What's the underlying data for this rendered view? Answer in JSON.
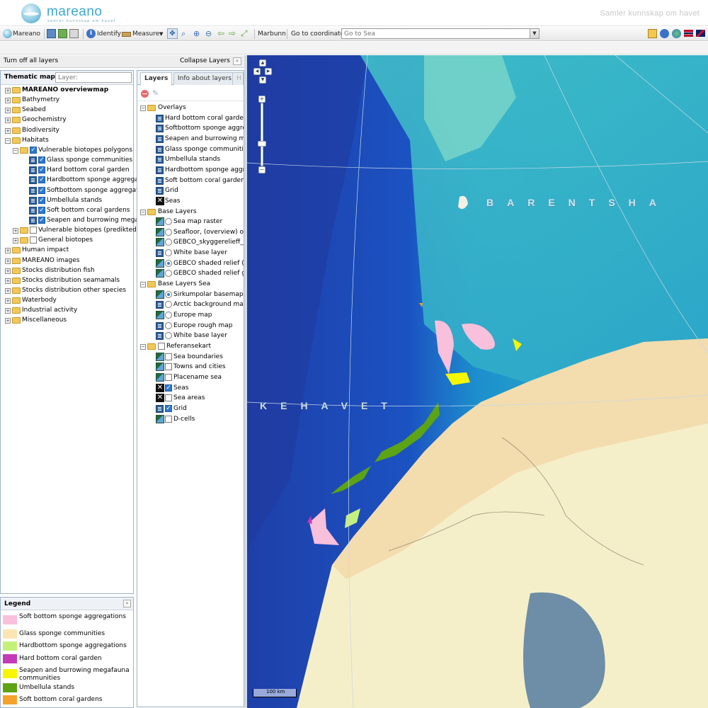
{
  "header": {
    "brand": "mareano",
    "brand_sub": "samler kunnskap om havet",
    "tagline": "Samler kunnskap om havet"
  },
  "toolbar": {
    "home_label": "Mareano",
    "identify_label": "Identify",
    "measure_label": "Measure",
    "marbunn_label": "Marbunn",
    "goto_coordinate_label": "Go to coordinate",
    "goto_sea_placeholder": "Go to Sea"
  },
  "left_panel": {
    "turn_off_label": "Turn off all layers",
    "collapse_label": "Collapse Layers"
  },
  "thematic": {
    "title": "Thematic maps",
    "layer_placeholder": "Layer:",
    "items": [
      {
        "label": "MAREANO overviewmap",
        "bold": true,
        "level": 0,
        "type": "folder"
      },
      {
        "label": "Bathymetry",
        "level": 0,
        "type": "folder"
      },
      {
        "label": "Seabed",
        "level": 0,
        "type": "folder"
      },
      {
        "label": "Geochemistry",
        "level": 0,
        "type": "folder"
      },
      {
        "label": "Biodiversity",
        "level": 0,
        "type": "folder"
      },
      {
        "label": "Habitats",
        "level": 0,
        "type": "folder",
        "expanded": true
      },
      {
        "label": "Vulnerable biotopes polygons",
        "level": 1,
        "type": "folder-check",
        "checked": true,
        "expanded": true
      },
      {
        "label": "Glass sponge communities",
        "level": 2,
        "type": "layer",
        "checked": true
      },
      {
        "label": "Hard bottom coral garden",
        "level": 2,
        "type": "layer",
        "checked": true
      },
      {
        "label": "Hardbottom sponge aggregations",
        "level": 2,
        "type": "layer",
        "checked": true
      },
      {
        "label": "Softbottom sponge aggregations",
        "level": 2,
        "type": "layer",
        "checked": true
      },
      {
        "label": "Umbellula stands",
        "level": 2,
        "type": "layer",
        "checked": true
      },
      {
        "label": "Soft bottom coral gardens",
        "level": 2,
        "type": "layer",
        "checked": true
      },
      {
        "label": "Seapen and burrowing megafauna",
        "level": 2,
        "type": "layer",
        "checked": true
      },
      {
        "label": "Vulnerable biotopes (predikted)",
        "level": 1,
        "type": "folder-check",
        "checked": false
      },
      {
        "label": "General biotopes",
        "level": 1,
        "type": "folder-check",
        "checked": false
      },
      {
        "label": "Human impact",
        "level": 0,
        "type": "folder"
      },
      {
        "label": "MAREANO images",
        "level": 0,
        "type": "folder"
      },
      {
        "label": "Stocks distribution fish",
        "level": 0,
        "type": "folder"
      },
      {
        "label": "Stocks distribution seamamals",
        "level": 0,
        "type": "folder"
      },
      {
        "label": "Stocks distribution other species",
        "level": 0,
        "type": "folder"
      },
      {
        "label": "Waterbody",
        "level": 0,
        "type": "folder"
      },
      {
        "label": "Industrial activity",
        "level": 0,
        "type": "folder"
      },
      {
        "label": "Miscellaneous",
        "level": 0,
        "type": "folder"
      }
    ]
  },
  "legend": {
    "title": "Legend",
    "items": [
      {
        "label": "Soft bottom sponge aggregations",
        "color": "#f9c0dc"
      },
      {
        "label": "Glass sponge communities",
        "color": "#fae6b4"
      },
      {
        "label": "Hardbottom sponge aggregations",
        "color": "#c5f07c"
      },
      {
        "label": "Hard bottom coral garden",
        "color": "#c43ab8"
      },
      {
        "label": "Seapen and burrowing megafauna communities",
        "color": "#f6f600"
      },
      {
        "label": "Umbellula stands",
        "color": "#5ca414"
      },
      {
        "label": "Soft bottom coral gardens",
        "color": "#f4a22c"
      },
      {
        "label": "Soft bottom sponge aggregations",
        "color": "#f9c0dc"
      }
    ]
  },
  "layers_panel": {
    "tabs": [
      "Layers",
      "Info about layers",
      "H"
    ],
    "items": [
      {
        "label": "Overlays",
        "type": "group"
      },
      {
        "label": "Hard bottom coral garden",
        "type": "overlay"
      },
      {
        "label": "Softbottom sponge aggregations",
        "type": "overlay"
      },
      {
        "label": "Seapen and burrowing megafauna",
        "type": "overlay"
      },
      {
        "label": "Glass sponge communities",
        "type": "overlay"
      },
      {
        "label": "Umbellula stands",
        "type": "overlay"
      },
      {
        "label": "Hardbottom sponge aggregations",
        "type": "overlay"
      },
      {
        "label": "Soft bottom coral gardens",
        "type": "overlay"
      },
      {
        "label": "Grid",
        "type": "overlay"
      },
      {
        "label": "Seas",
        "type": "overlay-x"
      },
      {
        "label": "Base Layers",
        "type": "group"
      },
      {
        "label": "Sea map raster",
        "type": "radio",
        "checked": false
      },
      {
        "label": "Seafloor, (overview) only",
        "type": "radio",
        "checked": false
      },
      {
        "label": "GEBCO_skyggerelieff_grey",
        "type": "radio",
        "checked": false
      },
      {
        "label": "White base layer",
        "type": "radio",
        "checked": false,
        "icon": "blue"
      },
      {
        "label": "GEBCO shaded relief (vector)",
        "type": "radio",
        "checked": true
      },
      {
        "label": "GEBCO shaded relief grey",
        "type": "radio",
        "checked": false
      },
      {
        "label": "Base Layers Sea",
        "type": "group"
      },
      {
        "label": "Sirkumpolar basemap",
        "type": "radio",
        "checked": true
      },
      {
        "label": "Arctic background map",
        "type": "radio",
        "checked": false,
        "icon": "blue"
      },
      {
        "label": "Europe map",
        "type": "radio",
        "checked": false
      },
      {
        "label": "Europe rough map",
        "type": "radio",
        "checked": false,
        "icon": "blue"
      },
      {
        "label": "White base layer",
        "type": "radio",
        "checked": false,
        "icon": "blue"
      },
      {
        "label": "Referansekart",
        "type": "group-check",
        "checked": false
      },
      {
        "label": "Sea boundaries",
        "type": "check",
        "checked": false
      },
      {
        "label": "Towns and cities",
        "type": "check",
        "checked": false
      },
      {
        "label": "Placename sea",
        "type": "check",
        "checked": false
      },
      {
        "label": "Seas",
        "type": "check-x",
        "checked": true
      },
      {
        "label": "Sea areas",
        "type": "check-x",
        "checked": false
      },
      {
        "label": "Grid",
        "type": "check",
        "checked": true,
        "icon": "blue"
      },
      {
        "label": "D-cells",
        "type": "check",
        "checked": false
      }
    ]
  },
  "map": {
    "label_barents": "BARENTSHA",
    "label_kehavet": "KEHAVET",
    "scale_label": "100 km"
  }
}
